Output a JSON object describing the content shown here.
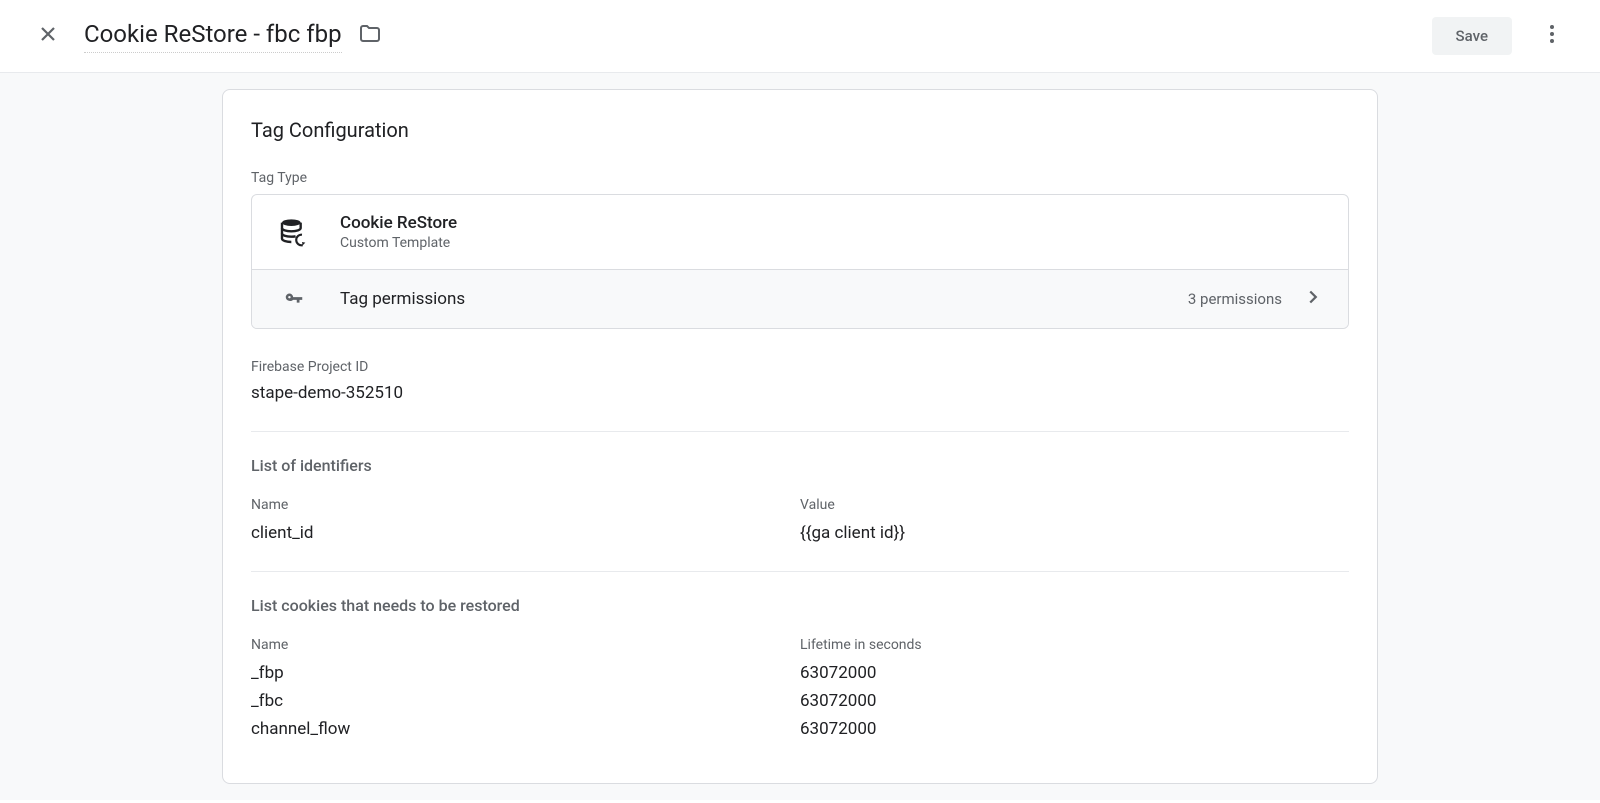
{
  "header": {
    "title": "Cookie ReStore - fbc fbp",
    "save_label": "Save"
  },
  "card": {
    "title": "Tag Configuration",
    "tag_type_label": "Tag Type",
    "tag_type": {
      "name": "Cookie ReStore",
      "subtitle": "Custom Template"
    },
    "permissions": {
      "label": "Tag permissions",
      "count_text": "3 permissions"
    },
    "firebase": {
      "label": "Firebase Project ID",
      "value": "stape-demo-352510"
    },
    "identifiers": {
      "section_title": "List of identifiers",
      "col1_header": "Name",
      "col2_header": "Value",
      "rows": [
        {
          "name": "client_id",
          "value": "{{ga client id}}"
        }
      ]
    },
    "cookies": {
      "section_title": "List cookies that needs to be restored",
      "col1_header": "Name",
      "col2_header": "Lifetime in seconds",
      "rows": [
        {
          "name": "_fbp",
          "lifetime": "63072000"
        },
        {
          "name": "_fbc",
          "lifetime": "63072000"
        },
        {
          "name": "channel_flow",
          "lifetime": "63072000"
        }
      ]
    }
  }
}
